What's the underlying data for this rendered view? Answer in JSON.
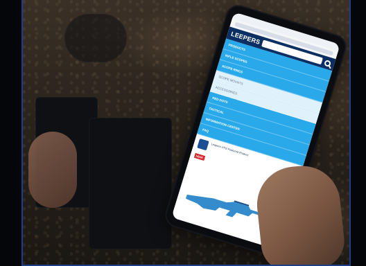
{
  "scene": {
    "subject": "Phone in hand",
    "accent_border": "#1d3f86"
  },
  "phone": {
    "header": {
      "brand": "LEEPERS"
    },
    "menu": {
      "items": [
        {
          "label": "PRODUCTS"
        },
        {
          "label": "RIFLE SCOPES"
        },
        {
          "label": "SCOPE RINGS"
        },
        {
          "label": "SCOPE MOUNTS",
          "sub": true
        },
        {
          "label": "ACCESSORIES",
          "sub": true
        },
        {
          "label": "RED DOTS"
        },
        {
          "label": "TACTICAL"
        },
        {
          "label": "INFORMATION CENTER"
        },
        {
          "label": "FAQ"
        }
      ]
    },
    "product": {
      "title": "Leapers UTG Featured Product",
      "badge": "NEW!"
    }
  },
  "colors": {
    "header": "#0c2f63",
    "menu": "#2aa9ea",
    "badge": "#d9242a"
  }
}
